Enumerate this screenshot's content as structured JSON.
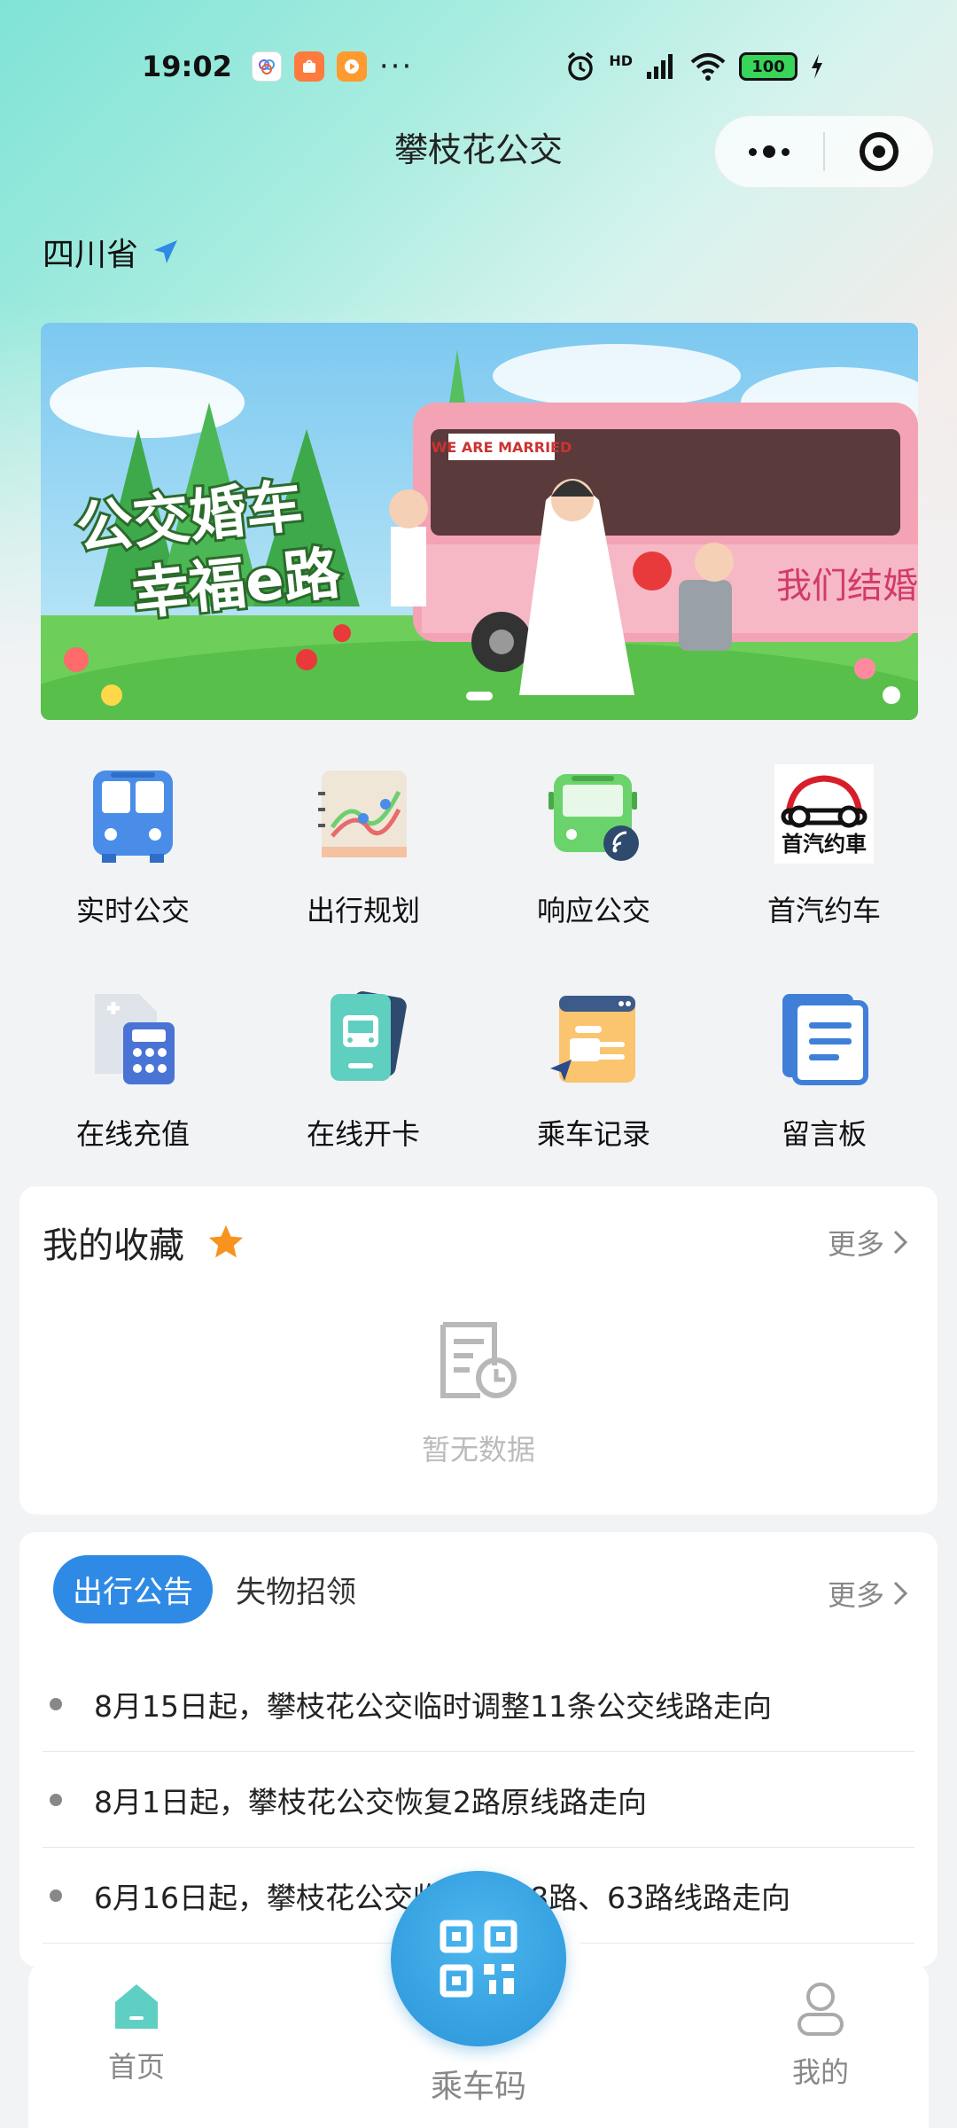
{
  "status_bar": {
    "time": "19:02",
    "more": "···",
    "signal": "HD",
    "battery": "100"
  },
  "header": {
    "title": "攀枝花公交"
  },
  "location": {
    "province": "四川省"
  },
  "banner": {
    "line1": "公交婚车",
    "line2": "幸福e路",
    "bus_sign": "WE ARE MARRIED",
    "bus_side": "我们结婚啦"
  },
  "grid": [
    {
      "label": "实时公交",
      "icon": "bus-icon"
    },
    {
      "label": "出行规划",
      "icon": "route-plan-icon"
    },
    {
      "label": "响应公交",
      "icon": "demand-bus-icon"
    },
    {
      "label": "首汽约车",
      "icon": "shouqi-logo-icon"
    },
    {
      "label": "在线充值",
      "icon": "recharge-icon"
    },
    {
      "label": "在线开卡",
      "icon": "card-icon"
    },
    {
      "label": "乘车记录",
      "icon": "ride-record-icon"
    },
    {
      "label": "留言板",
      "icon": "message-board-icon"
    }
  ],
  "shouqi_logo_text": "首汽约車",
  "favorites": {
    "title": "我的收藏",
    "more": "更多",
    "empty": "暂无数据"
  },
  "notices": {
    "tab_active": "出行公告",
    "tab_other": "失物招领",
    "more": "更多",
    "items": [
      "8月15日起，攀枝花公交临时调整11条公交线路走向",
      "8月1日起，攀枝花公交恢复2路原线路走向",
      "6月16日起，攀枝花公交临时调整8路、63路线路走向"
    ]
  },
  "bottom_nav": {
    "home": "首页",
    "code": "乘车码",
    "mine": "我的"
  },
  "colors": {
    "accent": "#2f8ae5",
    "star": "#f7931e",
    "qr": "#2a94d8"
  }
}
